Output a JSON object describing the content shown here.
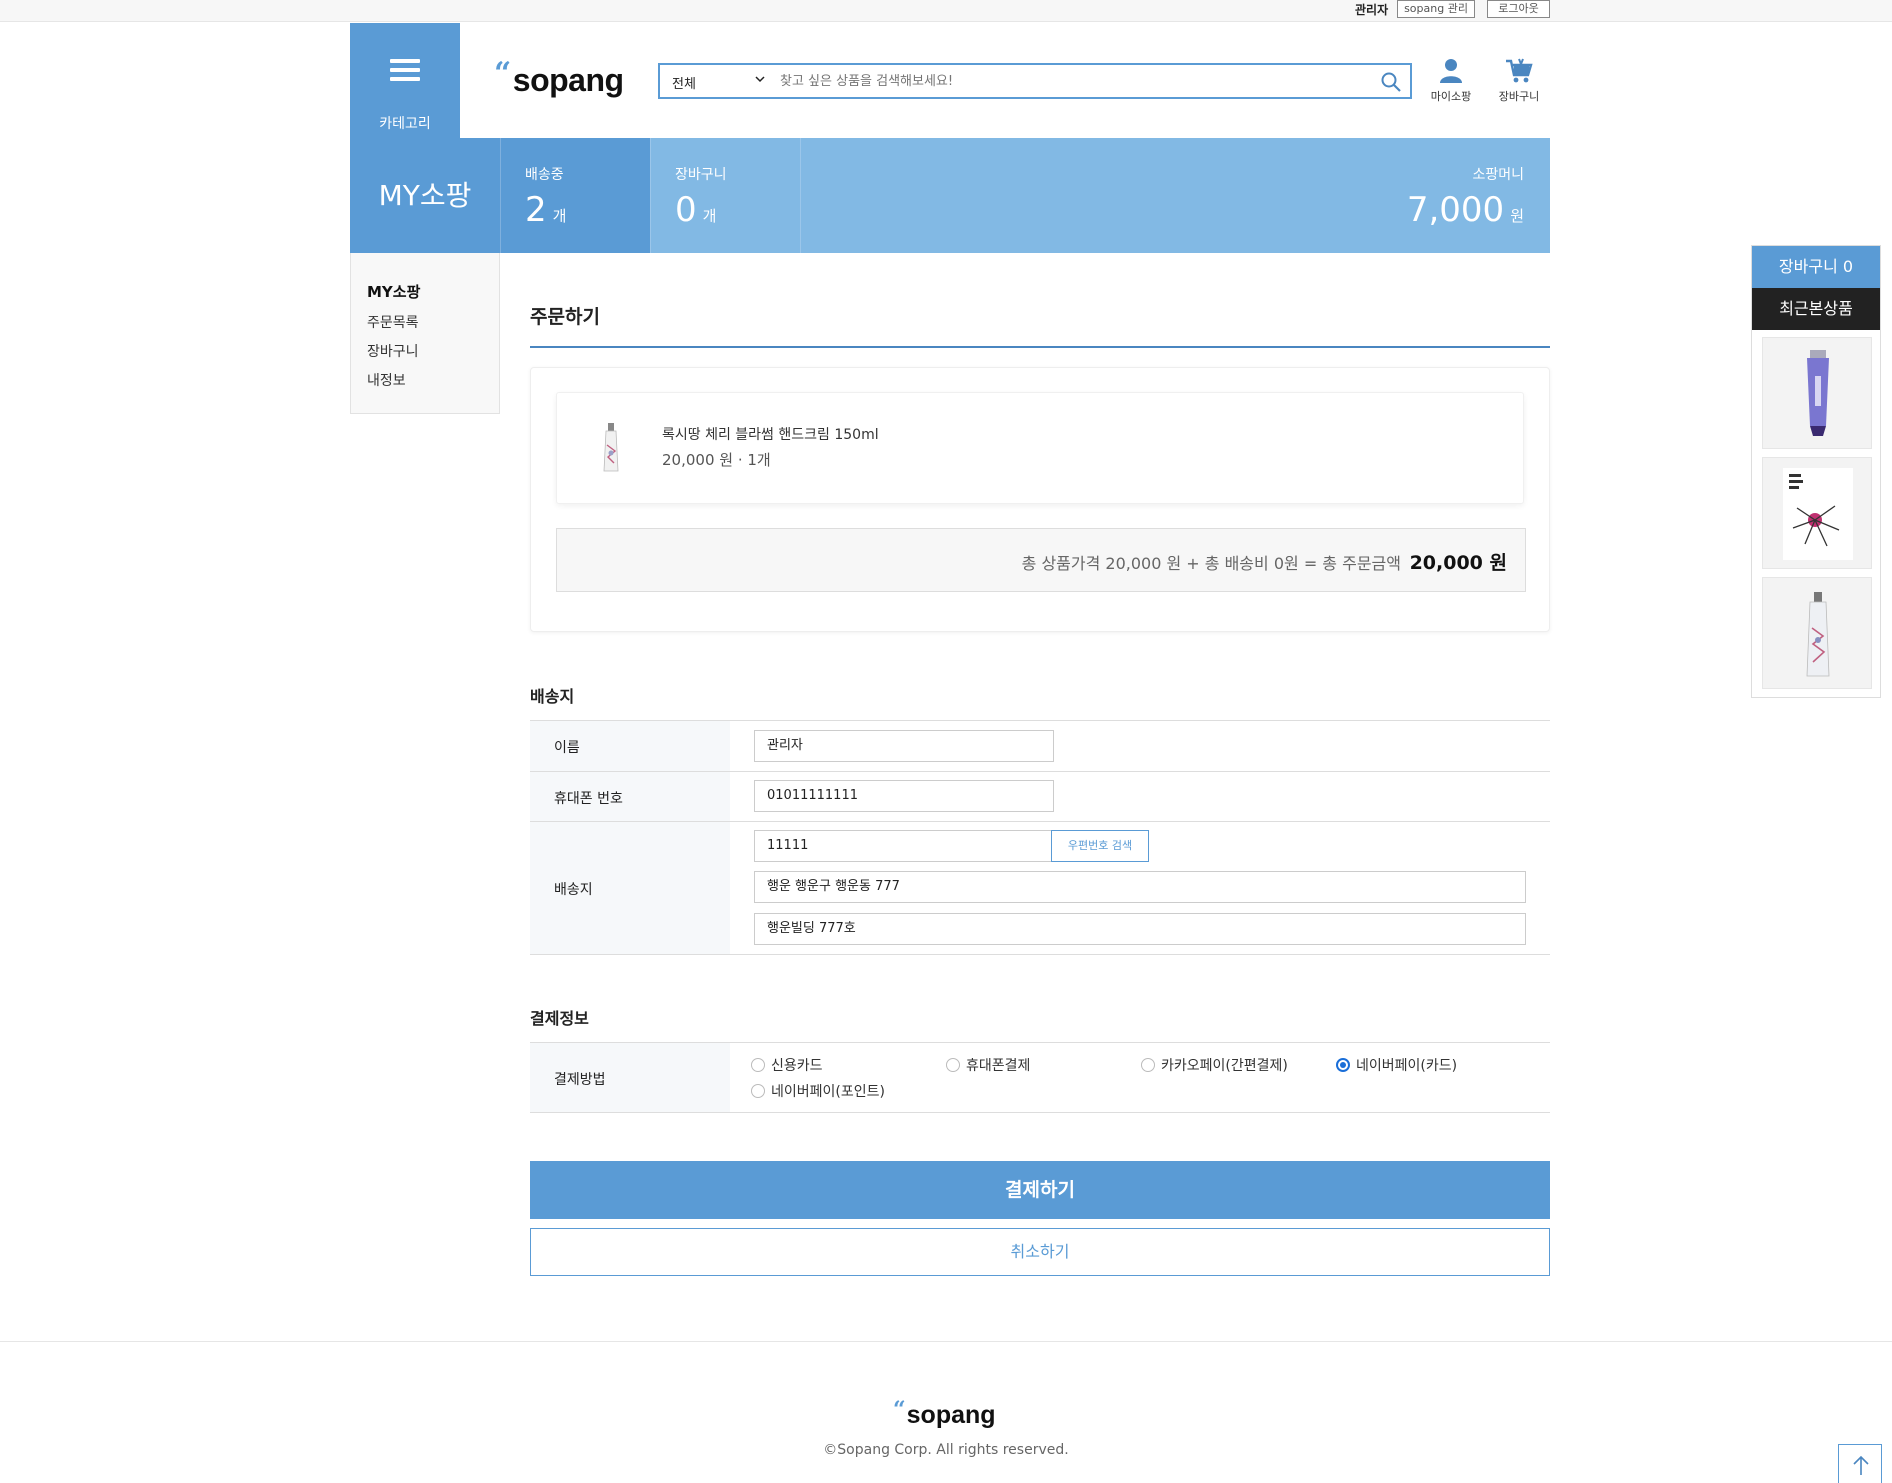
{
  "topbar": {
    "user": "관리자",
    "admin_btn": "sopang 관리",
    "logout_btn": "로그아웃"
  },
  "header": {
    "category_label": "카테고리",
    "logo_text": "sopang",
    "search_scope": "전체",
    "search_placeholder": "찾고 싶은 상품을 검색해보세요!",
    "mypage_label": "마이소팡",
    "cart_label": "장바구니"
  },
  "banner": {
    "title": "MY소팡",
    "shipping_label": "배송중",
    "shipping_count": "2",
    "shipping_unit": "개",
    "cart_label": "장바구니",
    "cart_count": "0",
    "cart_unit": "개",
    "money_label": "소팡머니",
    "money_value": "7,000",
    "money_unit": "원"
  },
  "sidebar": {
    "title": "MY소팡",
    "items": [
      {
        "label": "주문목록"
      },
      {
        "label": "장바구니"
      },
      {
        "label": "내정보"
      }
    ]
  },
  "order": {
    "title": "주문하기",
    "item_name": "록시땅 체리 블라썸 핸드크림 150ml",
    "item_price": "20,000 원 · 1개",
    "total_text": "총 상품가격 20,000 원 + 총 배송비 0원 = 총 주문금액",
    "total_amount": "20,000 원"
  },
  "shipping": {
    "section_title": "배송지",
    "name_label": "이름",
    "name_value": "관리자",
    "phone_label": "휴대폰 번호",
    "phone_value": "01011111111",
    "addr_label": "배송지",
    "zip_value": "11111",
    "zip_button": "우편번호 검색",
    "addr1_value": "행운 행운구 행운동 777",
    "addr2_value": "행운빌딩 777호"
  },
  "payment": {
    "section_title": "결제정보",
    "method_label": "결제방법",
    "options": [
      {
        "label": "신용카드",
        "selected": false
      },
      {
        "label": "휴대폰결제",
        "selected": false
      },
      {
        "label": "카카오페이(간편결제)",
        "selected": false
      },
      {
        "label": "네이버페이(카드)",
        "selected": true
      },
      {
        "label": "네이버페이(포인트)",
        "selected": false
      }
    ],
    "pay_button": "결제하기",
    "cancel_button": "취소하기"
  },
  "floating": {
    "cart_label": "장바구니 0",
    "recent_label": "최근본상품"
  },
  "footer": {
    "logo_text": "sopang",
    "copyright": "©Sopang Corp. All rights reserved."
  },
  "colors": {
    "accent": "#5a9bd5",
    "accent_light": "#82b9e4",
    "radio_selected": "#1a6ed8"
  }
}
